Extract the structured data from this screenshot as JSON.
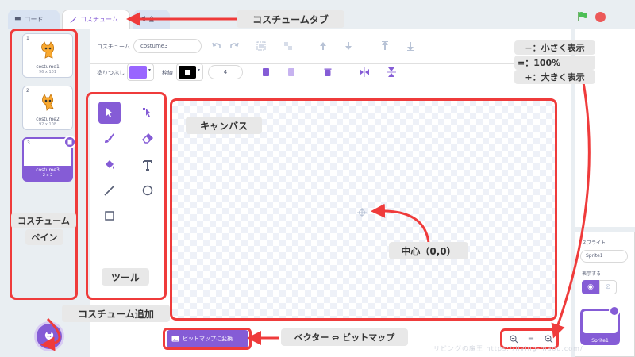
{
  "tabs": {
    "code": "コード",
    "costume": "コスチューム",
    "sound": "音"
  },
  "costumes": [
    {
      "num": "1",
      "name": "costume1",
      "size": "96 x 101"
    },
    {
      "num": "2",
      "name": "costume2",
      "size": "92 x 108"
    },
    {
      "num": "3",
      "name": "costume3",
      "size": "2 x 2"
    }
  ],
  "toolbar": {
    "costume_label": "コスチューム",
    "costume_name": "costume3",
    "fill_label": "塗りつぶし",
    "outline_label": "枠線",
    "outline_width": "4"
  },
  "convert_button": "ビットマップに変換",
  "zoom": {
    "out": "−",
    "reset": "=",
    "in": "+"
  },
  "sprite_panel": {
    "sprite_label": "スプライト",
    "sprite_name": "Sprite1",
    "show_label": "表示する",
    "thumb_name": "Sprite1"
  },
  "annotations": {
    "costume_tab": "コスチュームタブ",
    "zoom_minus": "−：小さく表示",
    "zoom_equal": "=：100%",
    "zoom_plus": "+：大きく表示",
    "canvas": "キャンバス",
    "center": "中心（0,0）",
    "pane_line1": "コスチューム",
    "pane_line2": "ペイン",
    "tools": "ツール",
    "add_costume": "コスチューム追加",
    "vector_bitmap": "ベクター ⇔ ビットマップ"
  },
  "watermark": "リビングの魔王 https://living-maou.com/",
  "colors": {
    "accent": "#855cd6",
    "annotation": "#ef3b3b",
    "flag": "#4cbf56",
    "stop": "#ec5959"
  }
}
